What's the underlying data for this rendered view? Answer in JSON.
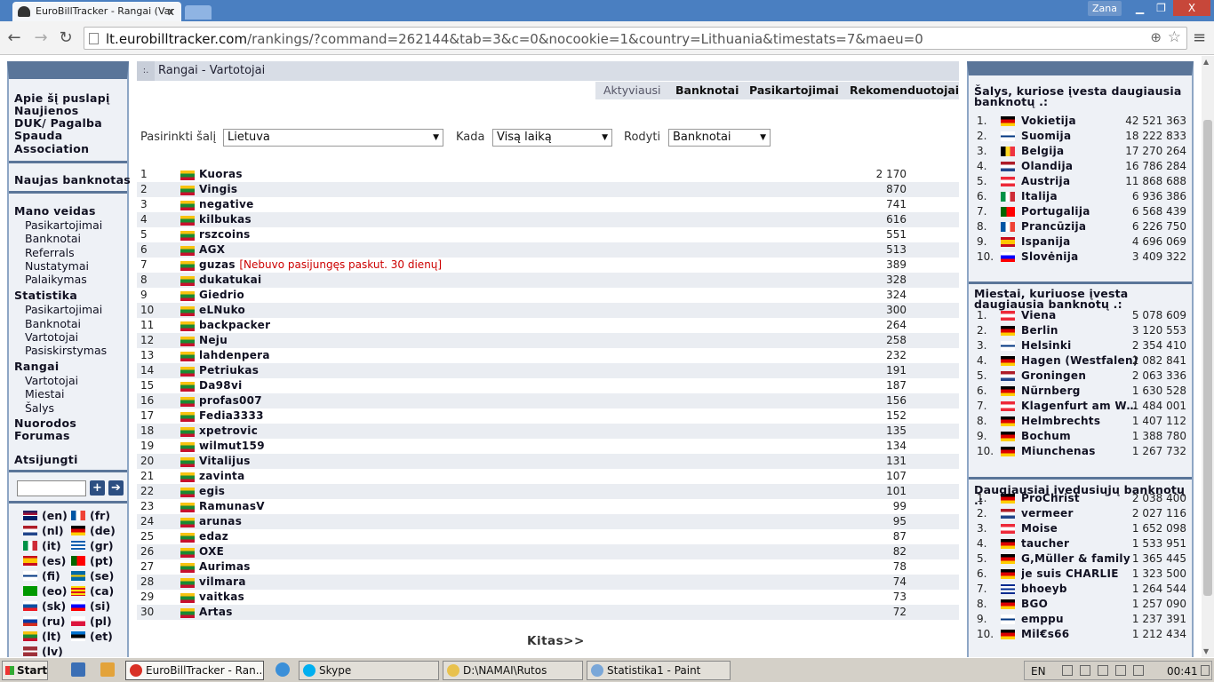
{
  "browser": {
    "tab_title": "EuroBillTracker - Rangai (Var",
    "tab_close": "x",
    "user": "Zana",
    "url_host": "lt.eurobilltracker.com",
    "url_path": "/rankings/?command=262144&tab=3&c=0&nocookie=1&country=Lithuania&timestats=7&maeu=0",
    "min": "▁",
    "max": "❐",
    "close": "X"
  },
  "leftnav": {
    "top": [
      "Apie šį puslapį",
      "Naujienos",
      "DUK/ Pagalba",
      "Spauda",
      "Association"
    ],
    "new_note": "Naujas banknotas",
    "mine_title": "Mano veidas",
    "mine": [
      "Pasikartojimai",
      "Banknotai",
      "Referrals",
      "Nustatymai",
      "Palaikymas"
    ],
    "stats_title": "Statistika",
    "stats": [
      "Pasikartojimai",
      "Banknotai",
      "Vartotojai",
      "Pasiskirstymas"
    ],
    "ranks_title": "Rangai",
    "ranks": [
      "Vartotojai",
      "Miestai",
      "Šalys"
    ],
    "links": [
      "Nuorodos",
      "Forumas"
    ],
    "logout": "Atsijungti",
    "search_plus": "+",
    "search_go": "➔",
    "languages": [
      {
        "code": "(en)",
        "flag": "en"
      },
      {
        "code": "(fr)",
        "flag": "fr"
      },
      {
        "code": "(nl)",
        "flag": "nl"
      },
      {
        "code": "(de)",
        "flag": "de"
      },
      {
        "code": "(it)",
        "flag": "it"
      },
      {
        "code": "(gr)",
        "flag": "gr"
      },
      {
        "code": "(es)",
        "flag": "es"
      },
      {
        "code": "(pt)",
        "flag": "pt"
      },
      {
        "code": "(fi)",
        "flag": "fi"
      },
      {
        "code": "(se)",
        "flag": "se"
      },
      {
        "code": "(eo)",
        "flag": "eo"
      },
      {
        "code": "(ca)",
        "flag": "ca"
      },
      {
        "code": "(sk)",
        "flag": "sk"
      },
      {
        "code": "(si)",
        "flag": "si"
      },
      {
        "code": "(ru)",
        "flag": "ru"
      },
      {
        "code": "(pl)",
        "flag": "pl"
      },
      {
        "code": "(lt)",
        "flag": "lt"
      },
      {
        "code": "(et)",
        "flag": "et"
      },
      {
        "code": "(lv)",
        "flag": "lv"
      }
    ]
  },
  "main": {
    "dots": ":.",
    "title": "Rangai - Vartotojai",
    "tabs": [
      "Aktyviausi",
      "Banknotai",
      "Pasikartojimai",
      "Rekomenduotojai"
    ],
    "filter_country_label": "Pasirinkti šalį",
    "filter_country": "Lietuva",
    "filter_when_label": "Kada",
    "filter_when": "Visą laiką",
    "filter_show_label": "Rodyti",
    "filter_show": "Banknotai",
    "rows": [
      {
        "rank": "1",
        "name": "Kuoras",
        "note": "",
        "value": "2 170"
      },
      {
        "rank": "2",
        "name": "Vingis",
        "note": "",
        "value": "870"
      },
      {
        "rank": "3",
        "name": "negative",
        "note": "",
        "value": "741"
      },
      {
        "rank": "4",
        "name": "kilbukas",
        "note": "",
        "value": "616"
      },
      {
        "rank": "5",
        "name": "rszcoins",
        "note": "",
        "value": "551"
      },
      {
        "rank": "6",
        "name": "AGX",
        "note": "",
        "value": "513"
      },
      {
        "rank": "7",
        "name": "guzas",
        "note": "[Nebuvo pasijungęs paskut. 30 dienų]",
        "value": "389"
      },
      {
        "rank": "8",
        "name": "dukatukai",
        "note": "",
        "value": "328"
      },
      {
        "rank": "9",
        "name": "Giedrio",
        "note": "",
        "value": "324"
      },
      {
        "rank": "10",
        "name": "eLNuko",
        "note": "",
        "value": "300"
      },
      {
        "rank": "11",
        "name": "backpacker",
        "note": "",
        "value": "264"
      },
      {
        "rank": "12",
        "name": "Neju",
        "note": "",
        "value": "258"
      },
      {
        "rank": "13",
        "name": "lahdenpera",
        "note": "",
        "value": "232"
      },
      {
        "rank": "14",
        "name": "Petriukas",
        "note": "",
        "value": "191"
      },
      {
        "rank": "15",
        "name": "Da98vi",
        "note": "",
        "value": "187"
      },
      {
        "rank": "16",
        "name": "profas007",
        "note": "",
        "value": "156"
      },
      {
        "rank": "17",
        "name": "Fedia3333",
        "note": "",
        "value": "152"
      },
      {
        "rank": "18",
        "name": "xpetrovic",
        "note": "",
        "value": "135"
      },
      {
        "rank": "19",
        "name": "wilmut159",
        "note": "",
        "value": "134"
      },
      {
        "rank": "20",
        "name": "Vitalijus",
        "note": "",
        "value": "131"
      },
      {
        "rank": "21",
        "name": "zavinta",
        "note": "",
        "value": "107"
      },
      {
        "rank": "22",
        "name": "egis",
        "note": "",
        "value": "101"
      },
      {
        "rank": "23",
        "name": "RamunasV",
        "note": "",
        "value": "99"
      },
      {
        "rank": "24",
        "name": "arunas",
        "note": "",
        "value": "95"
      },
      {
        "rank": "25",
        "name": "edaz",
        "note": "",
        "value": "87"
      },
      {
        "rank": "26",
        "name": "OXE",
        "note": "",
        "value": "82"
      },
      {
        "rank": "27",
        "name": "Aurimas",
        "note": "",
        "value": "78"
      },
      {
        "rank": "28",
        "name": "vilmara",
        "note": "",
        "value": "74"
      },
      {
        "rank": "29",
        "name": "vaitkas",
        "note": "",
        "value": "73"
      },
      {
        "rank": "30",
        "name": "Artas",
        "note": "",
        "value": "72"
      }
    ],
    "next": "Kitas>>"
  },
  "rightbar": {
    "countries_title": "Šalys, kuriose įvesta daugiausia banknotų .:",
    "countries": [
      {
        "rank": "1.",
        "flag": "de",
        "name": "Vokietija",
        "value": "42 521 363"
      },
      {
        "rank": "2.",
        "flag": "fi",
        "name": "Suomija",
        "value": "18 222 833"
      },
      {
        "rank": "3.",
        "flag": "be",
        "name": "Belgija",
        "value": "17 270 264"
      },
      {
        "rank": "4.",
        "flag": "nl",
        "name": "Olandija",
        "value": "16 786 284"
      },
      {
        "rank": "5.",
        "flag": "at",
        "name": "Austrija",
        "value": "11 868 688"
      },
      {
        "rank": "6.",
        "flag": "it",
        "name": "Italija",
        "value": "6 936 386"
      },
      {
        "rank": "7.",
        "flag": "pt",
        "name": "Portugalija",
        "value": "6 568 439"
      },
      {
        "rank": "8.",
        "flag": "fr",
        "name": "Prancūzija",
        "value": "6 226 750"
      },
      {
        "rank": "9.",
        "flag": "es",
        "name": "Ispanija",
        "value": "4 696 069"
      },
      {
        "rank": "10.",
        "flag": "si",
        "name": "Slovėnija",
        "value": "3 409 322"
      }
    ],
    "cities_title": "Miestai, kuriuose įvesta daugiausia banknotų .:",
    "cities": [
      {
        "rank": "1.",
        "flag": "at",
        "name": "Viena",
        "value": "5 078 609"
      },
      {
        "rank": "2.",
        "flag": "de",
        "name": "Berlin",
        "value": "3 120 553"
      },
      {
        "rank": "3.",
        "flag": "fi",
        "name": "Helsinki",
        "value": "2 354 410"
      },
      {
        "rank": "4.",
        "flag": "de",
        "name": "Hagen (Westfalen)",
        "value": "2 082 841"
      },
      {
        "rank": "5.",
        "flag": "nl",
        "name": "Groningen",
        "value": "2 063 336"
      },
      {
        "rank": "6.",
        "flag": "de",
        "name": "Nürnberg",
        "value": "1 630 528"
      },
      {
        "rank": "7.",
        "flag": "at",
        "name": "Klagenfurt am Wör...",
        "value": "1 484 001"
      },
      {
        "rank": "8.",
        "flag": "de",
        "name": "Helmbrechts",
        "value": "1 407 112"
      },
      {
        "rank": "9.",
        "flag": "de",
        "name": "Bochum",
        "value": "1 388 780"
      },
      {
        "rank": "10.",
        "flag": "de",
        "name": "Miunchenas",
        "value": "1 267 732"
      }
    ],
    "users_title": "Daugiausiai įvedusiųjų banknotų .:",
    "users": [
      {
        "rank": "1.",
        "flag": "de",
        "name": "ProChrist",
        "value": "2 038 400"
      },
      {
        "rank": "2.",
        "flag": "nl",
        "name": "vermeer",
        "value": "2 027 116"
      },
      {
        "rank": "3.",
        "flag": "at",
        "name": "Moise",
        "value": "1 652 098"
      },
      {
        "rank": "4.",
        "flag": "de",
        "name": "taucher",
        "value": "1 533 951"
      },
      {
        "rank": "5.",
        "flag": "de",
        "name": "G,Müller & family",
        "value": "1 365 445"
      },
      {
        "rank": "6.",
        "flag": "de",
        "name": "je suis CHARLIE",
        "value": "1 323 500"
      },
      {
        "rank": "7.",
        "flag": "cu",
        "name": "bhoeyb",
        "value": "1 264 544"
      },
      {
        "rank": "8.",
        "flag": "de",
        "name": "BGO",
        "value": "1 257 090"
      },
      {
        "rank": "9.",
        "flag": "fi",
        "name": "emppu",
        "value": "1 237 391"
      },
      {
        "rank": "10.",
        "flag": "de",
        "name": "Mil€s66",
        "value": "1 212 434"
      }
    ]
  },
  "taskbar": {
    "start": "Start",
    "items": [
      {
        "label": "EuroBillTracker - Ran...",
        "icon": "chrome-icon",
        "color": "#d93025"
      },
      {
        "label": "Skype",
        "icon": "skype-icon",
        "color": "#00aff0"
      },
      {
        "label": "D:\\NAMAI\\Rutos",
        "icon": "folder-icon",
        "color": "#e8c14d"
      },
      {
        "label": "Statistika1 - Paint",
        "icon": "paint-icon",
        "color": "#7aa7d8"
      }
    ],
    "lang": "EN",
    "clock": "00:41"
  }
}
